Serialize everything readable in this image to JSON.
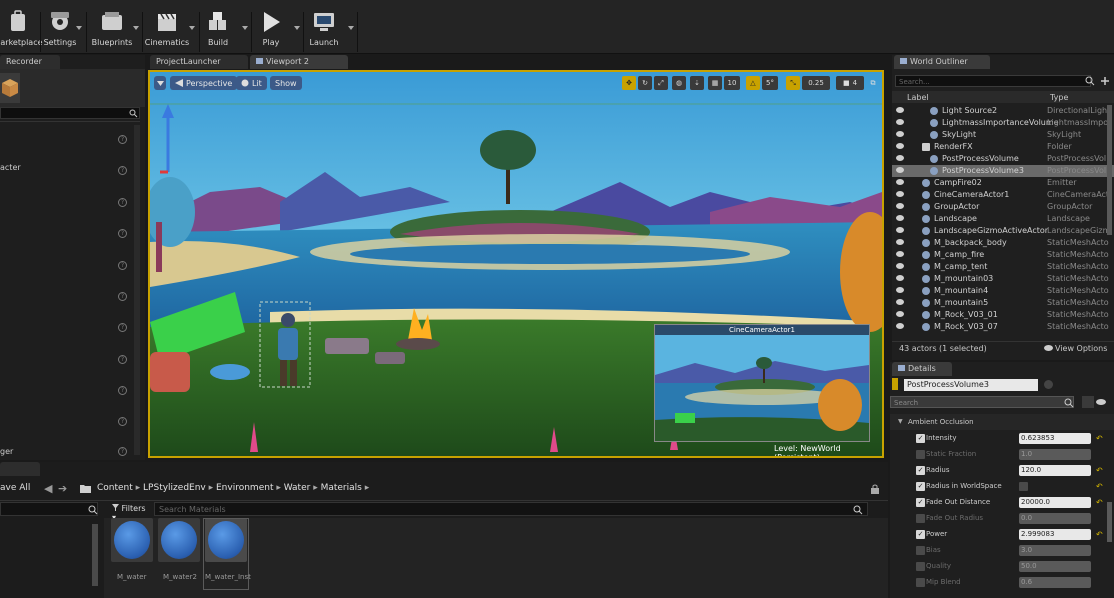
{
  "toolbar": {
    "buttons": [
      "Marketplace",
      "Settings",
      "Blueprints",
      "Cinematics",
      "Build",
      "Play",
      "Launch"
    ]
  },
  "left_panel": {
    "tab": "Recorder",
    "items": [
      "acter",
      "",
      ""
    ],
    "bottom_item": "ger"
  },
  "viewport": {
    "tabs": [
      "ProjectLauncher",
      "Viewport 2"
    ],
    "perspective": "Perspective",
    "lit": "Lit",
    "show": "Show",
    "grid_snap": "10",
    "rot_snap": "5°",
    "scale_snap": "0.25",
    "cam_speed": "4",
    "pip_title": "CineCameraActor1",
    "level_label": "Level:",
    "level_value": "NewWorld (Persistent)"
  },
  "outliner": {
    "tab": "World Outliner",
    "search_placeholder": "Search...",
    "col_label": "Label",
    "col_type": "Type",
    "rows": [
      {
        "label": "Light Source2",
        "type": "DirectionalLight",
        "indent": 2
      },
      {
        "label": "LightmassImportanceVolume",
        "type": "LightmassImpor",
        "indent": 2
      },
      {
        "label": "SkyLight",
        "type": "SkyLight",
        "indent": 2
      },
      {
        "label": "RenderFX",
        "type": "Folder",
        "indent": 1
      },
      {
        "label": "PostProcessVolume",
        "type": "PostProcessVol",
        "indent": 2
      },
      {
        "label": "PostProcessVolume3",
        "type": "PostProcessVol",
        "indent": 2
      },
      {
        "label": "CampFire02",
        "type": "Emitter",
        "indent": 1
      },
      {
        "label": "CineCameraActor1",
        "type": "CineCameraActo",
        "indent": 1
      },
      {
        "label": "GroupActor",
        "type": "GroupActor",
        "indent": 1
      },
      {
        "label": "Landscape",
        "type": "Landscape",
        "indent": 1
      },
      {
        "label": "LandscapeGizmoActiveActor",
        "type": "LandscapeGizm",
        "indent": 1
      },
      {
        "label": "M_backpack_body",
        "type": "StaticMeshActo",
        "indent": 1
      },
      {
        "label": "M_camp_fire",
        "type": "StaticMeshActo",
        "indent": 1
      },
      {
        "label": "M_camp_tent",
        "type": "StaticMeshActo",
        "indent": 1
      },
      {
        "label": "M_mountain03",
        "type": "StaticMeshActo",
        "indent": 1
      },
      {
        "label": "M_mountain4",
        "type": "StaticMeshActo",
        "indent": 1
      },
      {
        "label": "M_mountain5",
        "type": "StaticMeshActo",
        "indent": 1
      },
      {
        "label": "M_Rock_V03_01",
        "type": "StaticMeshActo",
        "indent": 1
      },
      {
        "label": "M_Rock_V03_07",
        "type": "StaticMeshActo",
        "indent": 1
      }
    ],
    "count": "43 actors (1 selected)",
    "view_options": "View Options"
  },
  "details": {
    "tab": "Details",
    "object_name": "PostProcessVolume3",
    "search_placeholder": "Search",
    "section": "Ambient Occlusion",
    "props": [
      {
        "name": "Intensity",
        "value": "0.623853",
        "checked": true
      },
      {
        "name": "Static Fraction",
        "value": "1.0",
        "checked": false
      },
      {
        "name": "Radius",
        "value": "120.0",
        "checked": true
      },
      {
        "name": "Radius in WorldSpace",
        "value": "",
        "checked": true
      },
      {
        "name": "Fade Out Distance",
        "value": "20000.0",
        "checked": true
      },
      {
        "name": "Fade Out Radius",
        "value": "0.0",
        "checked": false
      },
      {
        "name": "Power",
        "value": "2.999083",
        "checked": true
      },
      {
        "name": "Bias",
        "value": "3.0",
        "checked": false
      },
      {
        "name": "Quality",
        "value": "50.0",
        "checked": false
      },
      {
        "name": "Mip Blend",
        "value": "0.6",
        "checked": false
      }
    ]
  },
  "content": {
    "save_all": "ave All",
    "breadcrumb": [
      "Content",
      "LPStylizedEnv",
      "Environment",
      "Water",
      "Materials"
    ],
    "filters": "Filters",
    "search_placeholder": "Search Materials",
    "assets": [
      "M_water",
      "M_water2",
      "M_water_Inst"
    ]
  }
}
